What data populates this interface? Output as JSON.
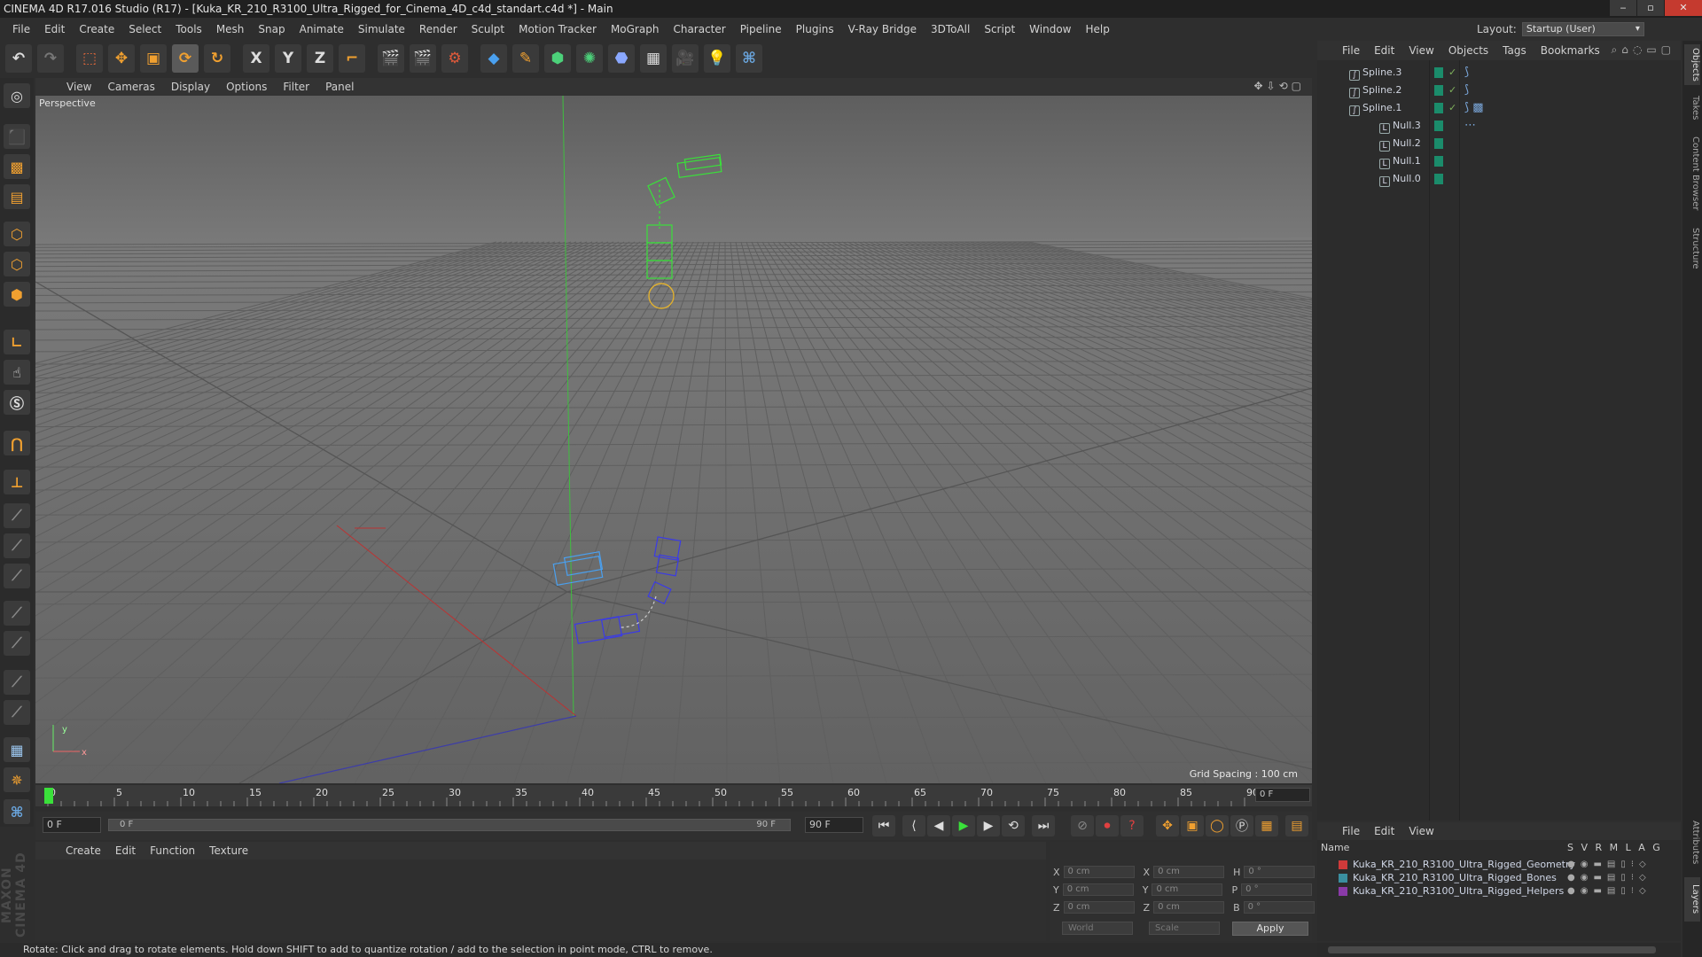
{
  "window": {
    "title": "CINEMA 4D R17.016 Studio (R17) - [Kuka_KR_210_R3100_Ultra_Rigged_for_Cinema_4D_c4d_standart.c4d *] - Main"
  },
  "menu": [
    "File",
    "Edit",
    "Create",
    "Select",
    "Tools",
    "Mesh",
    "Snap",
    "Animate",
    "Simulate",
    "Render",
    "Sculpt",
    "Motion Tracker",
    "MoGraph",
    "Character",
    "Pipeline",
    "Plugins",
    "V-Ray Bridge",
    "3DToAll",
    "Script",
    "Window",
    "Help"
  ],
  "layout": {
    "label": "Layout:",
    "value": "Startup (User)"
  },
  "toolbar": {
    "x_label": "X",
    "y_label": "Y",
    "z_label": "Z"
  },
  "viewport": {
    "menu": [
      "View",
      "Cameras",
      "Display",
      "Options",
      "Filter",
      "Panel"
    ],
    "label": "Perspective",
    "grid_spacing": "Grid Spacing : 100 cm",
    "axis_y": "y",
    "axis_x": "x"
  },
  "timeline": {
    "ticks": [
      "0",
      "5",
      "10",
      "15",
      "20",
      "25",
      "30",
      "35",
      "40",
      "45",
      "50",
      "55",
      "60",
      "65",
      "70",
      "75",
      "80",
      "85",
      "90"
    ],
    "current_frame_field": "0 F",
    "start_field": "0 F",
    "range_start": "0 F",
    "range_end": "90 F",
    "end_field": "90 F"
  },
  "material": {
    "menu": [
      "Create",
      "Edit",
      "Function",
      "Texture"
    ]
  },
  "coords": {
    "rows": [
      {
        "a": "X",
        "av": "0 cm",
        "b": "X",
        "bv": "0 cm",
        "c": "H",
        "cv": "0 °"
      },
      {
        "a": "Y",
        "av": "0 cm",
        "b": "Y",
        "bv": "0 cm",
        "c": "P",
        "cv": "0 °"
      },
      {
        "a": "Z",
        "av": "0 cm",
        "b": "Z",
        "bv": "0 cm",
        "c": "B",
        "cv": "0 °"
      }
    ],
    "space": "World",
    "mode": "Scale",
    "apply": "Apply"
  },
  "status": "Rotate: Click and drag to rotate elements. Hold down SHIFT to add to quantize rotation / add to the selection in point mode, CTRL to remove.",
  "objects": {
    "menu": [
      "File",
      "Edit",
      "View",
      "Objects",
      "Tags",
      "Bookmarks"
    ],
    "items": [
      {
        "name": "Spline.3",
        "type": "spline"
      },
      {
        "name": "Spline.2",
        "type": "spline"
      },
      {
        "name": "Spline.1",
        "type": "spline"
      },
      {
        "name": "Null.3",
        "type": "null"
      },
      {
        "name": "Null.2",
        "type": "null"
      },
      {
        "name": "Null.1",
        "type": "null"
      },
      {
        "name": "Null.0",
        "type": "null"
      }
    ]
  },
  "layers": {
    "menu": [
      "File",
      "Edit",
      "View"
    ],
    "header_name": "Name",
    "header_cols": "S V R M L A G",
    "items": [
      {
        "name": "Kuka_KR_210_R3100_Ultra_Rigged_Geometry",
        "color": "#d03a3a"
      },
      {
        "name": "Kuka_KR_210_R3100_Ultra_Rigged_Bones",
        "color": "#3a8fa0"
      },
      {
        "name": "Kuka_KR_210_R3100_Ultra_Rigged_Helpers",
        "color": "#8a3aa8"
      }
    ]
  },
  "side_tabs": [
    "Objects",
    "Takes",
    "Content Browser",
    "Structure",
    "Attributes",
    "Layers"
  ],
  "brand": "MAXON CINEMA 4D"
}
